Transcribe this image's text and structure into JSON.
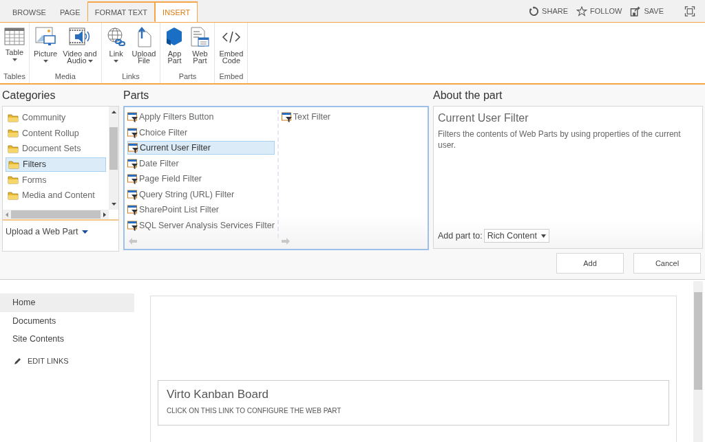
{
  "ribbon_tabs": [
    {
      "label": "BROWSE",
      "selected": false,
      "contextual": false
    },
    {
      "label": "PAGE",
      "selected": false,
      "contextual": false
    },
    {
      "label": "FORMAT TEXT",
      "selected": false,
      "contextual": true
    },
    {
      "label": "INSERT",
      "selected": true,
      "contextual": true
    }
  ],
  "actions": [
    {
      "kind": "share",
      "label": "SHARE"
    },
    {
      "kind": "follow",
      "label": "FOLLOW"
    },
    {
      "kind": "save",
      "label": "SAVE"
    },
    {
      "kind": "focus"
    }
  ],
  "ribbon_groups": [
    {
      "label": "Tables",
      "buttons": [
        {
          "kind": "table",
          "lines": [
            "Table"
          ],
          "dropdown": true
        }
      ]
    },
    {
      "label": "Media",
      "buttons": [
        {
          "kind": "picture",
          "lines": [
            "Picture"
          ],
          "dropdown": true
        },
        {
          "kind": "video",
          "lines": [
            "Video and",
            "Audio"
          ],
          "dropdown": true
        }
      ]
    },
    {
      "label": "Links",
      "buttons": [
        {
          "kind": "link",
          "lines": [
            "Link"
          ],
          "dropdown": true
        },
        {
          "kind": "upload",
          "lines": [
            "Upload",
            "File"
          ],
          "dropdown": false
        }
      ]
    },
    {
      "label": "Parts",
      "buttons": [
        {
          "kind": "app",
          "lines": [
            "App",
            "Part"
          ],
          "dropdown": false
        },
        {
          "kind": "webpart",
          "lines": [
            "Web",
            "Part"
          ],
          "dropdown": false
        }
      ]
    },
    {
      "label": "Embed",
      "buttons": [
        {
          "kind": "embed",
          "lines": [
            "Embed",
            "Code"
          ],
          "dropdown": false
        }
      ]
    }
  ],
  "categories": {
    "title": "Categories",
    "items": [
      {
        "label": "Community",
        "selected": false
      },
      {
        "label": "Content Rollup",
        "selected": false
      },
      {
        "label": "Document Sets",
        "selected": false
      },
      {
        "label": "Filters",
        "selected": true
      },
      {
        "label": "Forms",
        "selected": false
      },
      {
        "label": "Media and Content",
        "selected": false
      }
    ],
    "upload": "Upload a Web Part"
  },
  "parts": {
    "title": "Parts",
    "columns": [
      [
        {
          "label": "Apply Filters Button",
          "selected": false
        },
        {
          "label": "Choice Filter",
          "selected": false
        },
        {
          "label": "Current User Filter",
          "selected": true
        },
        {
          "label": "Date Filter",
          "selected": false
        },
        {
          "label": "Page Field Filter",
          "selected": false
        },
        {
          "label": "Query String (URL) Filter",
          "selected": false
        },
        {
          "label": "SharePoint List Filter",
          "selected": false
        },
        {
          "label": "SQL Server Analysis Services Filter",
          "selected": false
        }
      ],
      [
        {
          "label": "Text Filter",
          "selected": false
        }
      ]
    ]
  },
  "about": {
    "title": "About the part",
    "name": "Current User Filter",
    "description": "Filters the contents of Web Parts by using properties of the current user.",
    "add_to_label": "Add part to:",
    "add_to_value": "Rich Content"
  },
  "buttons": [
    "Add",
    "Cancel"
  ],
  "nav": [
    {
      "label": "Home",
      "selected": true
    },
    {
      "label": "Documents",
      "selected": false
    },
    {
      "label": "Site Contents",
      "selected": false
    }
  ],
  "edit_links": "EDIT LINKS",
  "webpart": {
    "title": "Virto Kanban Board",
    "link": "CLICK ON THIS LINK TO CONFIGURE THE WEB PART"
  }
}
